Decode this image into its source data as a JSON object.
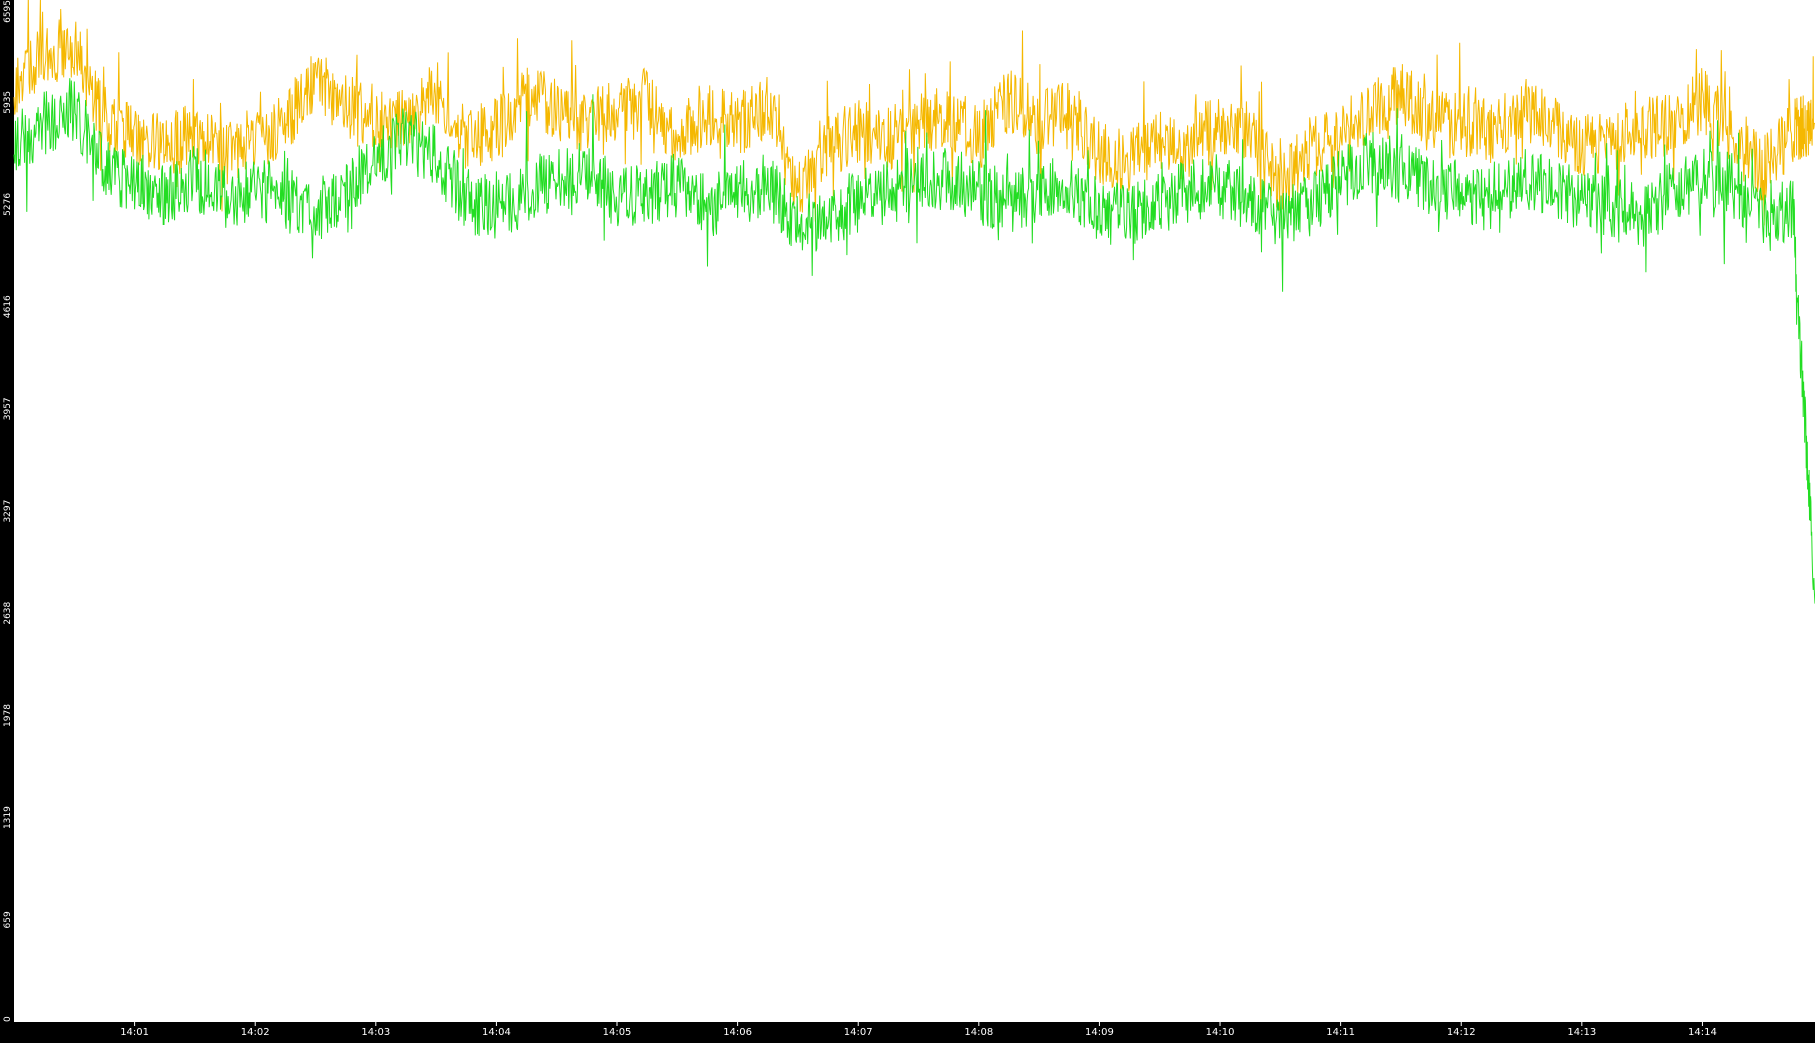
{
  "chart_data": {
    "type": "line",
    "title": "",
    "xlabel": "",
    "ylabel": "",
    "ylim": [
      0,
      6595
    ],
    "yticks": [
      "0",
      "659",
      "1319",
      "1978",
      "2638",
      "3297",
      "3957",
      "4616",
      "5276",
      "5935",
      "6595"
    ],
    "xticks": [
      "14:01",
      "14:02",
      "14:03",
      "14:04",
      "14:05",
      "14:06",
      "14:07",
      "14:08",
      "14:09",
      "14:10",
      "14:11",
      "14:12",
      "14:13",
      "14:14"
    ],
    "xlim": [
      "14:00:00",
      "14:14:56"
    ],
    "grid": false,
    "legend": "none",
    "colors": {
      "background": "#000000",
      "plot_area": "#ffffff",
      "axis_text": "#ffffff"
    },
    "series": [
      {
        "color": "#f5b800",
        "x": [
          "14:00:00",
          "14:00:15",
          "14:00:30",
          "14:00:45",
          "14:01:00",
          "14:01:15",
          "14:01:30",
          "14:01:45",
          "14:02:00",
          "14:02:15",
          "14:02:30",
          "14:02:45",
          "14:03:00",
          "14:03:15",
          "14:03:30",
          "14:03:45",
          "14:04:00",
          "14:04:15",
          "14:04:30",
          "14:04:45",
          "14:05:00",
          "14:05:15",
          "14:05:30",
          "14:05:45",
          "14:06:00",
          "14:06:15",
          "14:06:30",
          "14:06:45",
          "14:07:00",
          "14:07:15",
          "14:07:30",
          "14:07:45",
          "14:08:00",
          "14:08:15",
          "14:08:30",
          "14:08:45",
          "14:09:00",
          "14:09:15",
          "14:09:30",
          "14:09:45",
          "14:10:00",
          "14:10:15",
          "14:10:30",
          "14:10:45",
          "14:11:00",
          "14:11:15",
          "14:11:30",
          "14:11:45",
          "14:12:00",
          "14:12:15",
          "14:12:30",
          "14:12:45",
          "14:13:00",
          "14:13:15",
          "14:13:30",
          "14:13:45",
          "14:14:00",
          "14:14:15",
          "14:14:30",
          "14:14:45",
          "14:14:56"
        ],
        "values": [
          6050,
          6250,
          6300,
          5800,
          5700,
          5650,
          5750,
          5600,
          5700,
          5800,
          6100,
          5900,
          5850,
          5800,
          6000,
          5700,
          5750,
          5950,
          5900,
          5800,
          5900,
          5950,
          5700,
          5850,
          5800,
          5900,
          5350,
          5650,
          5750,
          5700,
          5800,
          5850,
          5700,
          5950,
          5800,
          5900,
          5600,
          5550,
          5700,
          5650,
          5800,
          5700,
          5400,
          5650,
          5700,
          5900,
          6000,
          5800,
          5800,
          5750,
          5900,
          5800,
          5650,
          5700,
          5750,
          5800,
          5950,
          5750,
          5500,
          5750,
          5800
        ]
      },
      {
        "color": "#22dd22",
        "x": [
          "14:00:00",
          "14:00:15",
          "14:00:30",
          "14:00:45",
          "14:01:00",
          "14:01:15",
          "14:01:30",
          "14:01:45",
          "14:02:00",
          "14:02:15",
          "14:02:30",
          "14:02:45",
          "14:03:00",
          "14:03:15",
          "14:03:30",
          "14:03:45",
          "14:04:00",
          "14:04:15",
          "14:04:30",
          "14:04:45",
          "14:05:00",
          "14:05:15",
          "14:05:30",
          "14:05:45",
          "14:06:00",
          "14:06:15",
          "14:06:30",
          "14:06:45",
          "14:07:00",
          "14:07:15",
          "14:07:30",
          "14:07:45",
          "14:08:00",
          "14:08:15",
          "14:08:30",
          "14:08:45",
          "14:09:00",
          "14:09:15",
          "14:09:30",
          "14:09:45",
          "14:10:00",
          "14:10:15",
          "14:10:30",
          "14:10:45",
          "14:11:00",
          "14:11:15",
          "14:11:30",
          "14:11:45",
          "14:12:00",
          "14:12:15",
          "14:12:30",
          "14:12:45",
          "14:13:00",
          "14:13:15",
          "14:13:30",
          "14:13:45",
          "14:14:00",
          "14:14:15",
          "14:14:30",
          "14:14:45",
          "14:14:56"
        ],
        "values": [
          5650,
          5800,
          5900,
          5500,
          5400,
          5350,
          5450,
          5300,
          5400,
          5300,
          5250,
          5350,
          5600,
          5700,
          5600,
          5300,
          5250,
          5350,
          5450,
          5500,
          5300,
          5350,
          5400,
          5300,
          5350,
          5400,
          5150,
          5200,
          5300,
          5350,
          5400,
          5450,
          5350,
          5300,
          5350,
          5400,
          5250,
          5200,
          5300,
          5350,
          5400,
          5300,
          5200,
          5250,
          5450,
          5550,
          5500,
          5400,
          5350,
          5300,
          5450,
          5400,
          5300,
          5250,
          5200,
          5350,
          5450,
          5400,
          5200,
          5250,
          2700
        ]
      }
    ]
  }
}
